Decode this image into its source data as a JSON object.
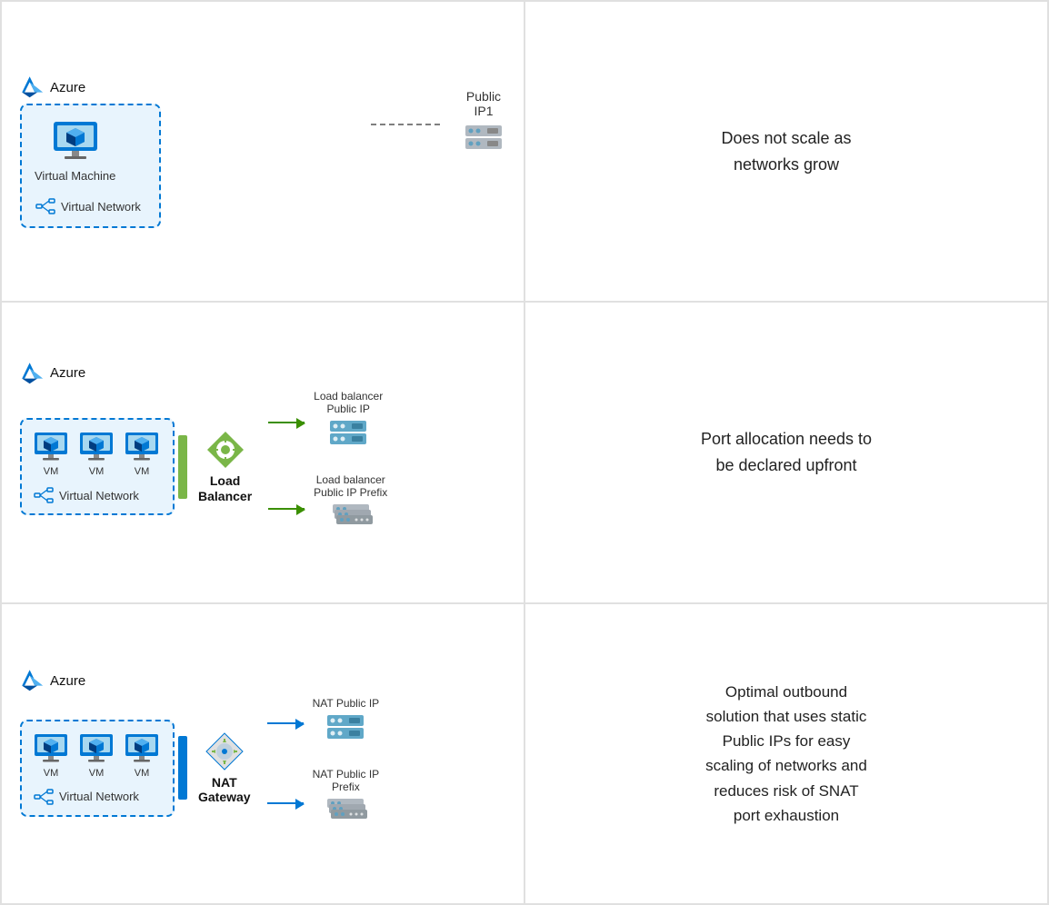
{
  "rows": [
    {
      "id": "row1",
      "diagram": {
        "azure_label": "Azure",
        "container_label": "Virtual Network",
        "vm_label": "Virtual Machine",
        "public_ip_label": "Public IP1"
      },
      "description": "Does not scale as\nnetworks grow"
    },
    {
      "id": "row2",
      "diagram": {
        "azure_label": "Azure",
        "container_label": "Virtual Network",
        "vm_labels": [
          "VM",
          "VM",
          "VM"
        ],
        "connector_label": "Load\nBalancer",
        "target1_label": "Load balancer\nPublic IP",
        "target2_label": "Load balancer\nPublic IP Prefix"
      },
      "description": "Port allocation needs to\nbe declared upfront"
    },
    {
      "id": "row3",
      "diagram": {
        "azure_label": "Azure",
        "container_label": "Virtual Network",
        "vm_labels": [
          "VM",
          "VM",
          "VM"
        ],
        "connector_label": "NAT\nGateway",
        "target1_label": "NAT Public IP",
        "target2_label": "NAT Public IP\nPrefix"
      },
      "description": "Optimal outbound\nsolution that uses static\nPublic IPs for easy\nscaling of networks and\nreduces risk of SNAT\nport exhaustion"
    }
  ]
}
